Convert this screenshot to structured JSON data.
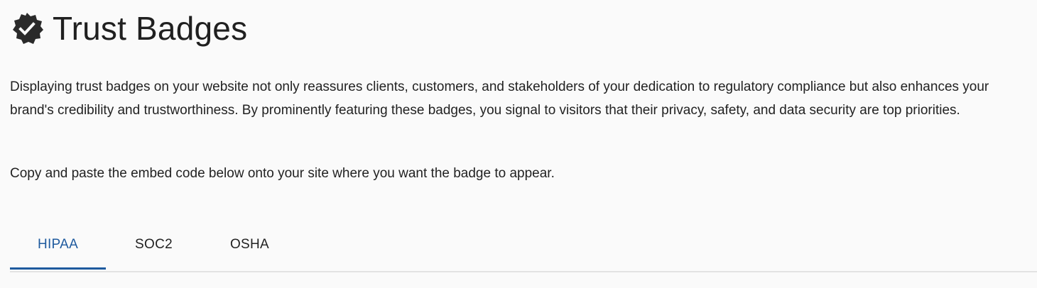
{
  "header": {
    "icon": "verified-badge-icon",
    "title": "Trust Badges"
  },
  "content": {
    "description": "Displaying trust badges on your website not only reassures clients, customers, and stakeholders of your dedication to regulatory compliance but also enhances your brand's credibility and trustworthiness. By prominently featuring these badges, you signal to visitors that their privacy, safety, and data security are top priorities.",
    "instructions": "Copy and paste the embed code below onto your site where you want the badge to appear."
  },
  "tabs": [
    {
      "label": "HIPAA",
      "active": true
    },
    {
      "label": "SOC2",
      "active": false
    },
    {
      "label": "OSHA",
      "active": false
    }
  ],
  "colors": {
    "accent": "#1e5a9e",
    "background": "#fafafa",
    "icon": "#2a2a2a"
  }
}
